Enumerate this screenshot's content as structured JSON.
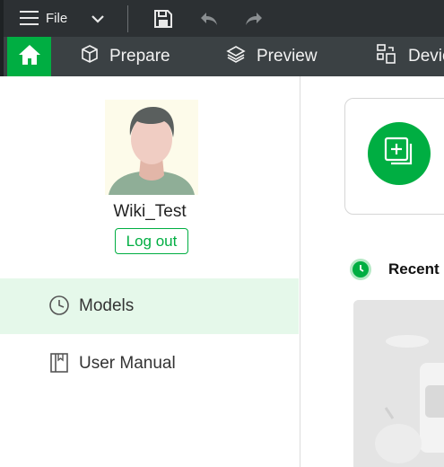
{
  "titlebar": {
    "file_label": "File",
    "icons": [
      "hamburger-menu-icon",
      "chevron-down-icon",
      "save-icon",
      "undo-icon",
      "redo-icon"
    ]
  },
  "tabs": {
    "home_icon": "home-icon",
    "items": [
      {
        "label": "Prepare",
        "icon": "cube-icon"
      },
      {
        "label": "Preview",
        "icon": "layers-icon"
      },
      {
        "label": "Devic",
        "icon": "device-icon"
      }
    ]
  },
  "sidebar": {
    "username": "Wiki_Test",
    "logout_label": "Log out",
    "nav": [
      {
        "label": "Models",
        "icon": "clock-icon",
        "selected": true
      },
      {
        "label": "User Manual",
        "icon": "book-icon",
        "selected": false
      }
    ]
  },
  "main": {
    "create_icon": "add-project-icon",
    "recent_title": "Recent",
    "recent_icon": "recent-clock-icon"
  },
  "colors": {
    "accent": "#00ae42",
    "titlebar_bg": "#2c3033",
    "tabbar_bg": "#3b4144",
    "selected_nav_bg": "#e5f8ea"
  }
}
